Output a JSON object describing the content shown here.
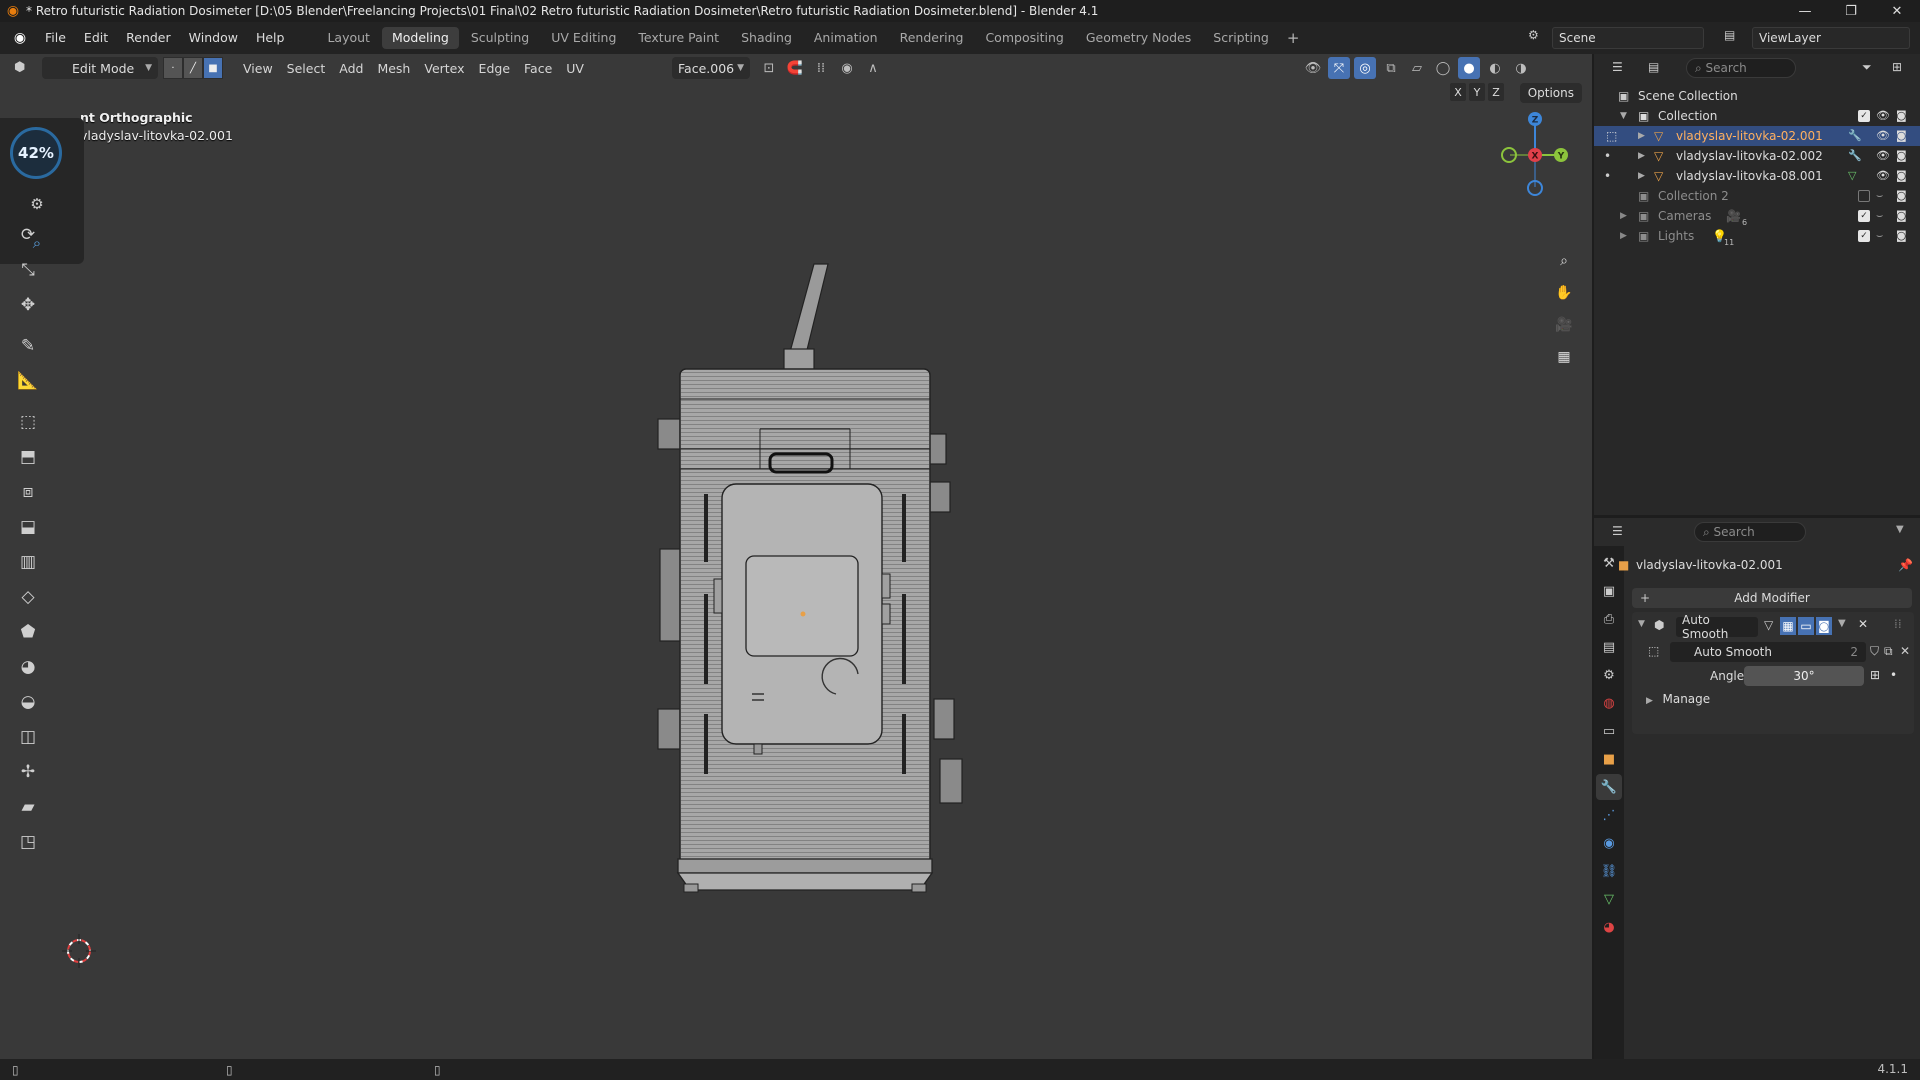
{
  "title_bar": {
    "title": "* Retro futuristic Radiation Dosimeter [D:\\05 Blender\\Freelancing Projects\\01 Final\\02 Retro futuristic Radiation Dosimeter\\Retro futuristic Radiation Dosimeter.blend] - Blender 4.1"
  },
  "menu": {
    "items": [
      "File",
      "Edit",
      "Render",
      "Window",
      "Help"
    ]
  },
  "workspaces": {
    "tabs": [
      "Layout",
      "Modeling",
      "Sculpting",
      "UV Editing",
      "Texture Paint",
      "Shading",
      "Animation",
      "Rendering",
      "Compositing",
      "Geometry Nodes",
      "Scripting"
    ],
    "active": "Modeling",
    "add_label": "+"
  },
  "scene": {
    "name": "Scene",
    "view_layer": "ViewLayer"
  },
  "viewport": {
    "mode": "Edit Mode",
    "menus": [
      "View",
      "Select",
      "Add",
      "Mesh",
      "Vertex",
      "Edge",
      "Face",
      "UV"
    ],
    "face_dropdown": "Face.006",
    "options_label": "Options",
    "axes": [
      "X",
      "Y",
      "Z"
    ],
    "view_name": "nt Orthographic",
    "object_name": "vladyslav-litovka-02.001",
    "performance_percent": "42%",
    "gizmo_labels": {
      "x": "X",
      "y": "Y",
      "z": "Z"
    }
  },
  "outliner": {
    "search_placeholder": "Search",
    "scene_collection": "Scene Collection",
    "collection": "Collection",
    "objects": [
      {
        "name": "vladyslav-litovka-02.001",
        "selected": true
      },
      {
        "name": "vladyslav-litovka-02.002",
        "selected": false
      },
      {
        "name": "vladyslav-litovka-08.001",
        "selected": false
      }
    ],
    "other_collections": [
      {
        "name": "Collection 2"
      },
      {
        "name": "Cameras",
        "count": "6"
      },
      {
        "name": "Lights",
        "count": "11"
      }
    ]
  },
  "properties": {
    "search_placeholder": "Search",
    "object_name": "vladyslav-litovka-02.001",
    "add_modifier": "Add Modifier",
    "modifier_name": "Auto Smooth",
    "node_group": "Auto Smooth",
    "node_users": "2",
    "angle_label": "Angle",
    "angle_value": "30°",
    "manage_label": "Manage"
  },
  "status_bar": {
    "version": "4.1.1"
  },
  "colors": {
    "accent_blue": "#4772b3",
    "selection_row": "#334d80",
    "object_orange": "#e8a048",
    "axis_x": "#e0404a",
    "axis_y": "#8cc43c",
    "axis_z": "#3d86d9"
  }
}
